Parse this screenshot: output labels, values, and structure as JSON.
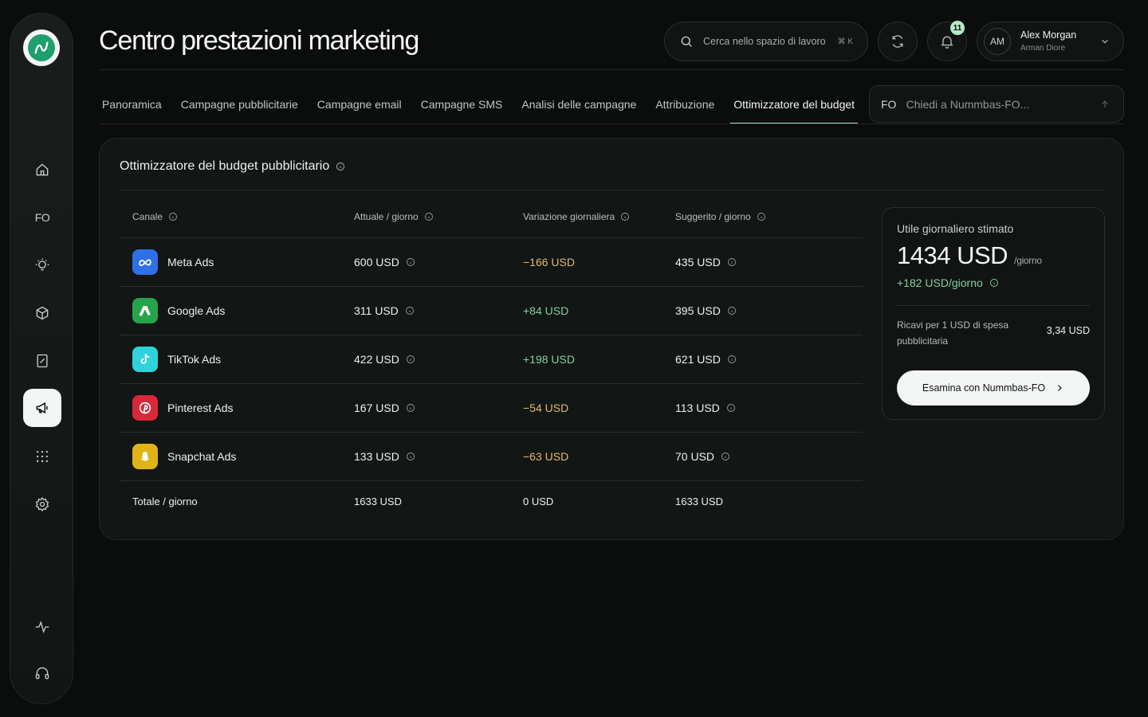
{
  "header": {
    "title": "Centro prestazioni marketing",
    "search_placeholder": "Cerca nello spazio di lavoro",
    "search_shortcut": "⌘ K",
    "notifications_count": "11",
    "user": {
      "initials": "AM",
      "name": "Alex Morgan",
      "subtitle": "Arman Diore"
    }
  },
  "sidebar": {
    "fo_label": "FO",
    "items": [
      "home-icon",
      "fo-icon",
      "lightbulb-icon",
      "box-icon",
      "report-icon",
      "megaphone-icon",
      "grid-icon",
      "settings-icon",
      "activity-icon",
      "headset-icon"
    ],
    "active": "megaphone-icon"
  },
  "tabs": [
    "Panoramica",
    "Campagne pubblicitarie",
    "Campagne email",
    "Campagne SMS",
    "Analisi delle campagne",
    "Attribuzione",
    "Ottimizzatore del budget pubblicitario"
  ],
  "ask": {
    "fo_label": "FO",
    "placeholder": "Chiedi a Nummbas-FO..."
  },
  "card": {
    "title": "Ottimizzatore del budget pubblicitario",
    "columns": [
      "Canale",
      "Attuale / giorno",
      "Variazione giornaliera",
      "Suggerito / giorno"
    ],
    "rows": [
      {
        "channel": "Meta Ads",
        "icon": "meta-icon",
        "color": "#2f6fe8",
        "current": "600 USD",
        "change": "−166 USD",
        "change_type": "neg",
        "suggested": "435 USD"
      },
      {
        "channel": "Google Ads",
        "icon": "google-ads-icon",
        "color": "#27a34c",
        "current": "311 USD",
        "change": "+84 USD",
        "change_type": "pos",
        "suggested": "395 USD"
      },
      {
        "channel": "TikTok Ads",
        "icon": "tiktok-icon",
        "color": "#2ed3dc",
        "current": "422 USD",
        "change": "+198 USD",
        "change_type": "pos",
        "suggested": "621 USD"
      },
      {
        "channel": "Pinterest Ads",
        "icon": "pinterest-icon",
        "color": "#d8283a",
        "current": "167 USD",
        "change": "−54 USD",
        "change_type": "neg",
        "suggested": "113 USD"
      },
      {
        "channel": "Snapchat Ads",
        "icon": "snapchat-icon",
        "color": "#e0b416",
        "current": "133 USD",
        "change": "−63 USD",
        "change_type": "neg",
        "suggested": "70 USD"
      }
    ],
    "total": {
      "label": "Totale / giorno",
      "current": "1633 USD",
      "change": "0 USD",
      "suggested": "1633 USD"
    }
  },
  "panel": {
    "label": "Utile giornaliero stimato",
    "value": "1434 USD",
    "unit": "/giorno",
    "delta": "+182 USD/giorno",
    "roi_label": "Ricavi per 1 USD di spesa pubblicitaria",
    "roi_value": "3,34 USD",
    "button": "Esamina con Nummbas-FO"
  },
  "colors": {
    "accent": "#9fe0b8",
    "positive": "#86cf9c",
    "negative": "#e3b96a",
    "brand": "#1f9e6e"
  }
}
